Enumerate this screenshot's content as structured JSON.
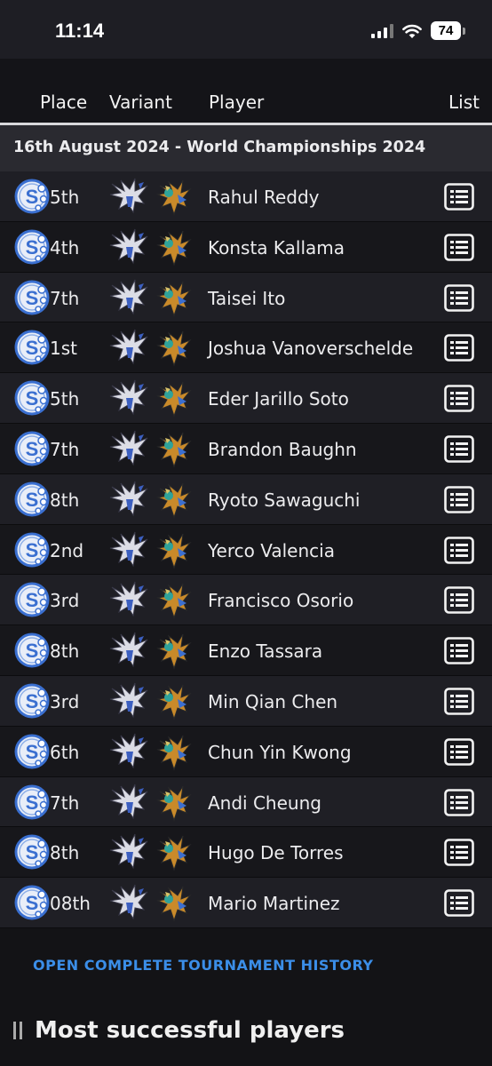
{
  "status_bar": {
    "time": "11:14",
    "battery": "74"
  },
  "table_header": {
    "place": "Place",
    "variant": "Variant",
    "player": "Player",
    "list": "List"
  },
  "tournament": {
    "title": "16th August 2024 - World Championships 2024"
  },
  "rows": [
    {
      "place": "5th",
      "player": "Rahul Reddy"
    },
    {
      "place": "4th",
      "player": "Konsta Kallama"
    },
    {
      "place": "7th",
      "player": "Taisei Ito"
    },
    {
      "place": "1st",
      "player": "Joshua Vanoverschelde"
    },
    {
      "place": "5th",
      "player": "Eder Jarillo Soto"
    },
    {
      "place": "7th",
      "player": "Brandon Baughn"
    },
    {
      "place": "8th",
      "player": "Ryoto Sawaguchi"
    },
    {
      "place": "2nd",
      "player": "Yerco Valencia"
    },
    {
      "place": "3rd",
      "player": "Francisco Osorio"
    },
    {
      "place": "8th",
      "player": "Enzo Tassara"
    },
    {
      "place": "3rd",
      "player": "Min Qian Chen"
    },
    {
      "place": "6th",
      "player": "Chun Yin Kwong"
    },
    {
      "place": "7th",
      "player": "Andi Cheung"
    },
    {
      "place": "8th",
      "player": "Hugo De Torres"
    },
    {
      "place": "08th",
      "player": "Mario Martinez"
    }
  ],
  "icons": {
    "place_badge": "s-circle-icon",
    "variant_1": "lugia-sprite-icon",
    "variant_2": "bird-sprite-icon",
    "list": "decklist-icon"
  },
  "history_link": "OPEN COMPLETE TOURNAMENT HISTORY",
  "section": {
    "title": "Most successful players"
  },
  "colors": {
    "background": "#131316",
    "row_alt": "#1f1f25",
    "link": "#3b8ee8",
    "badge": "#3a6fd0"
  }
}
